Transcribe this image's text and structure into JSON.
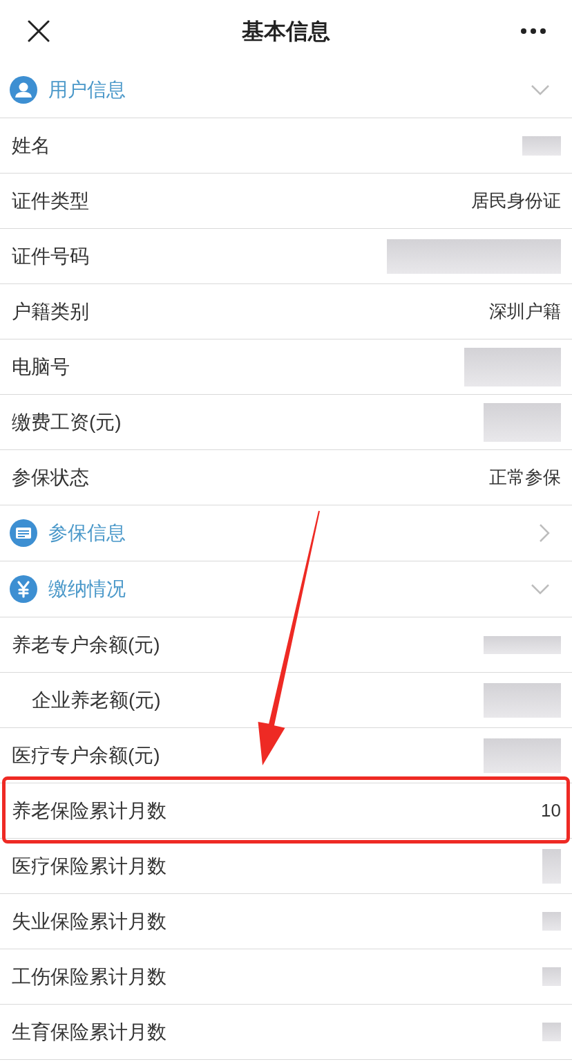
{
  "header": {
    "title": "基本信息"
  },
  "sections": [
    {
      "title": "用户信息",
      "expanded": true,
      "rows": [
        {
          "label": "姓名",
          "kind": "blurred",
          "highlighted": false
        },
        {
          "label": "证件类型",
          "kind": "text",
          "value": "居民身份证",
          "highlighted": false
        },
        {
          "label": "证件号码",
          "kind": "blurred",
          "highlighted": false
        },
        {
          "label": "户籍类别",
          "kind": "text",
          "value": "深圳户籍",
          "highlighted": false
        },
        {
          "label": "电脑号",
          "kind": "blurred",
          "highlighted": false
        },
        {
          "label": "缴费工资(元)",
          "kind": "blurred",
          "highlighted": false
        },
        {
          "label": "参保状态",
          "kind": "text",
          "value": "正常参保",
          "highlighted": false
        }
      ]
    },
    {
      "title": "参保信息",
      "expanded": false
    },
    {
      "title": "缴纳情况",
      "expanded": true,
      "rows": [
        {
          "label": "养老专户余额(元)",
          "kind": "blurred",
          "highlighted": false,
          "children": [
            {
              "label": "企业养老额(元)",
              "kind": "blurred",
              "highlighted": false
            }
          ]
        },
        {
          "label": "医疗专户余额(元)",
          "kind": "blurred",
          "highlighted": false
        },
        {
          "label": "养老保险累计月数",
          "kind": "text",
          "value": "10",
          "highlighted": true
        },
        {
          "label": "医疗保险累计月数",
          "kind": "blurred",
          "highlighted": false
        },
        {
          "label": "失业保险累计月数",
          "kind": "blurred",
          "highlighted": false
        },
        {
          "label": "工伤保险累计月数",
          "kind": "blurred",
          "highlighted": false
        },
        {
          "label": "生育保险累计月数",
          "kind": "blurred",
          "highlighted": false
        }
      ]
    }
  ]
}
